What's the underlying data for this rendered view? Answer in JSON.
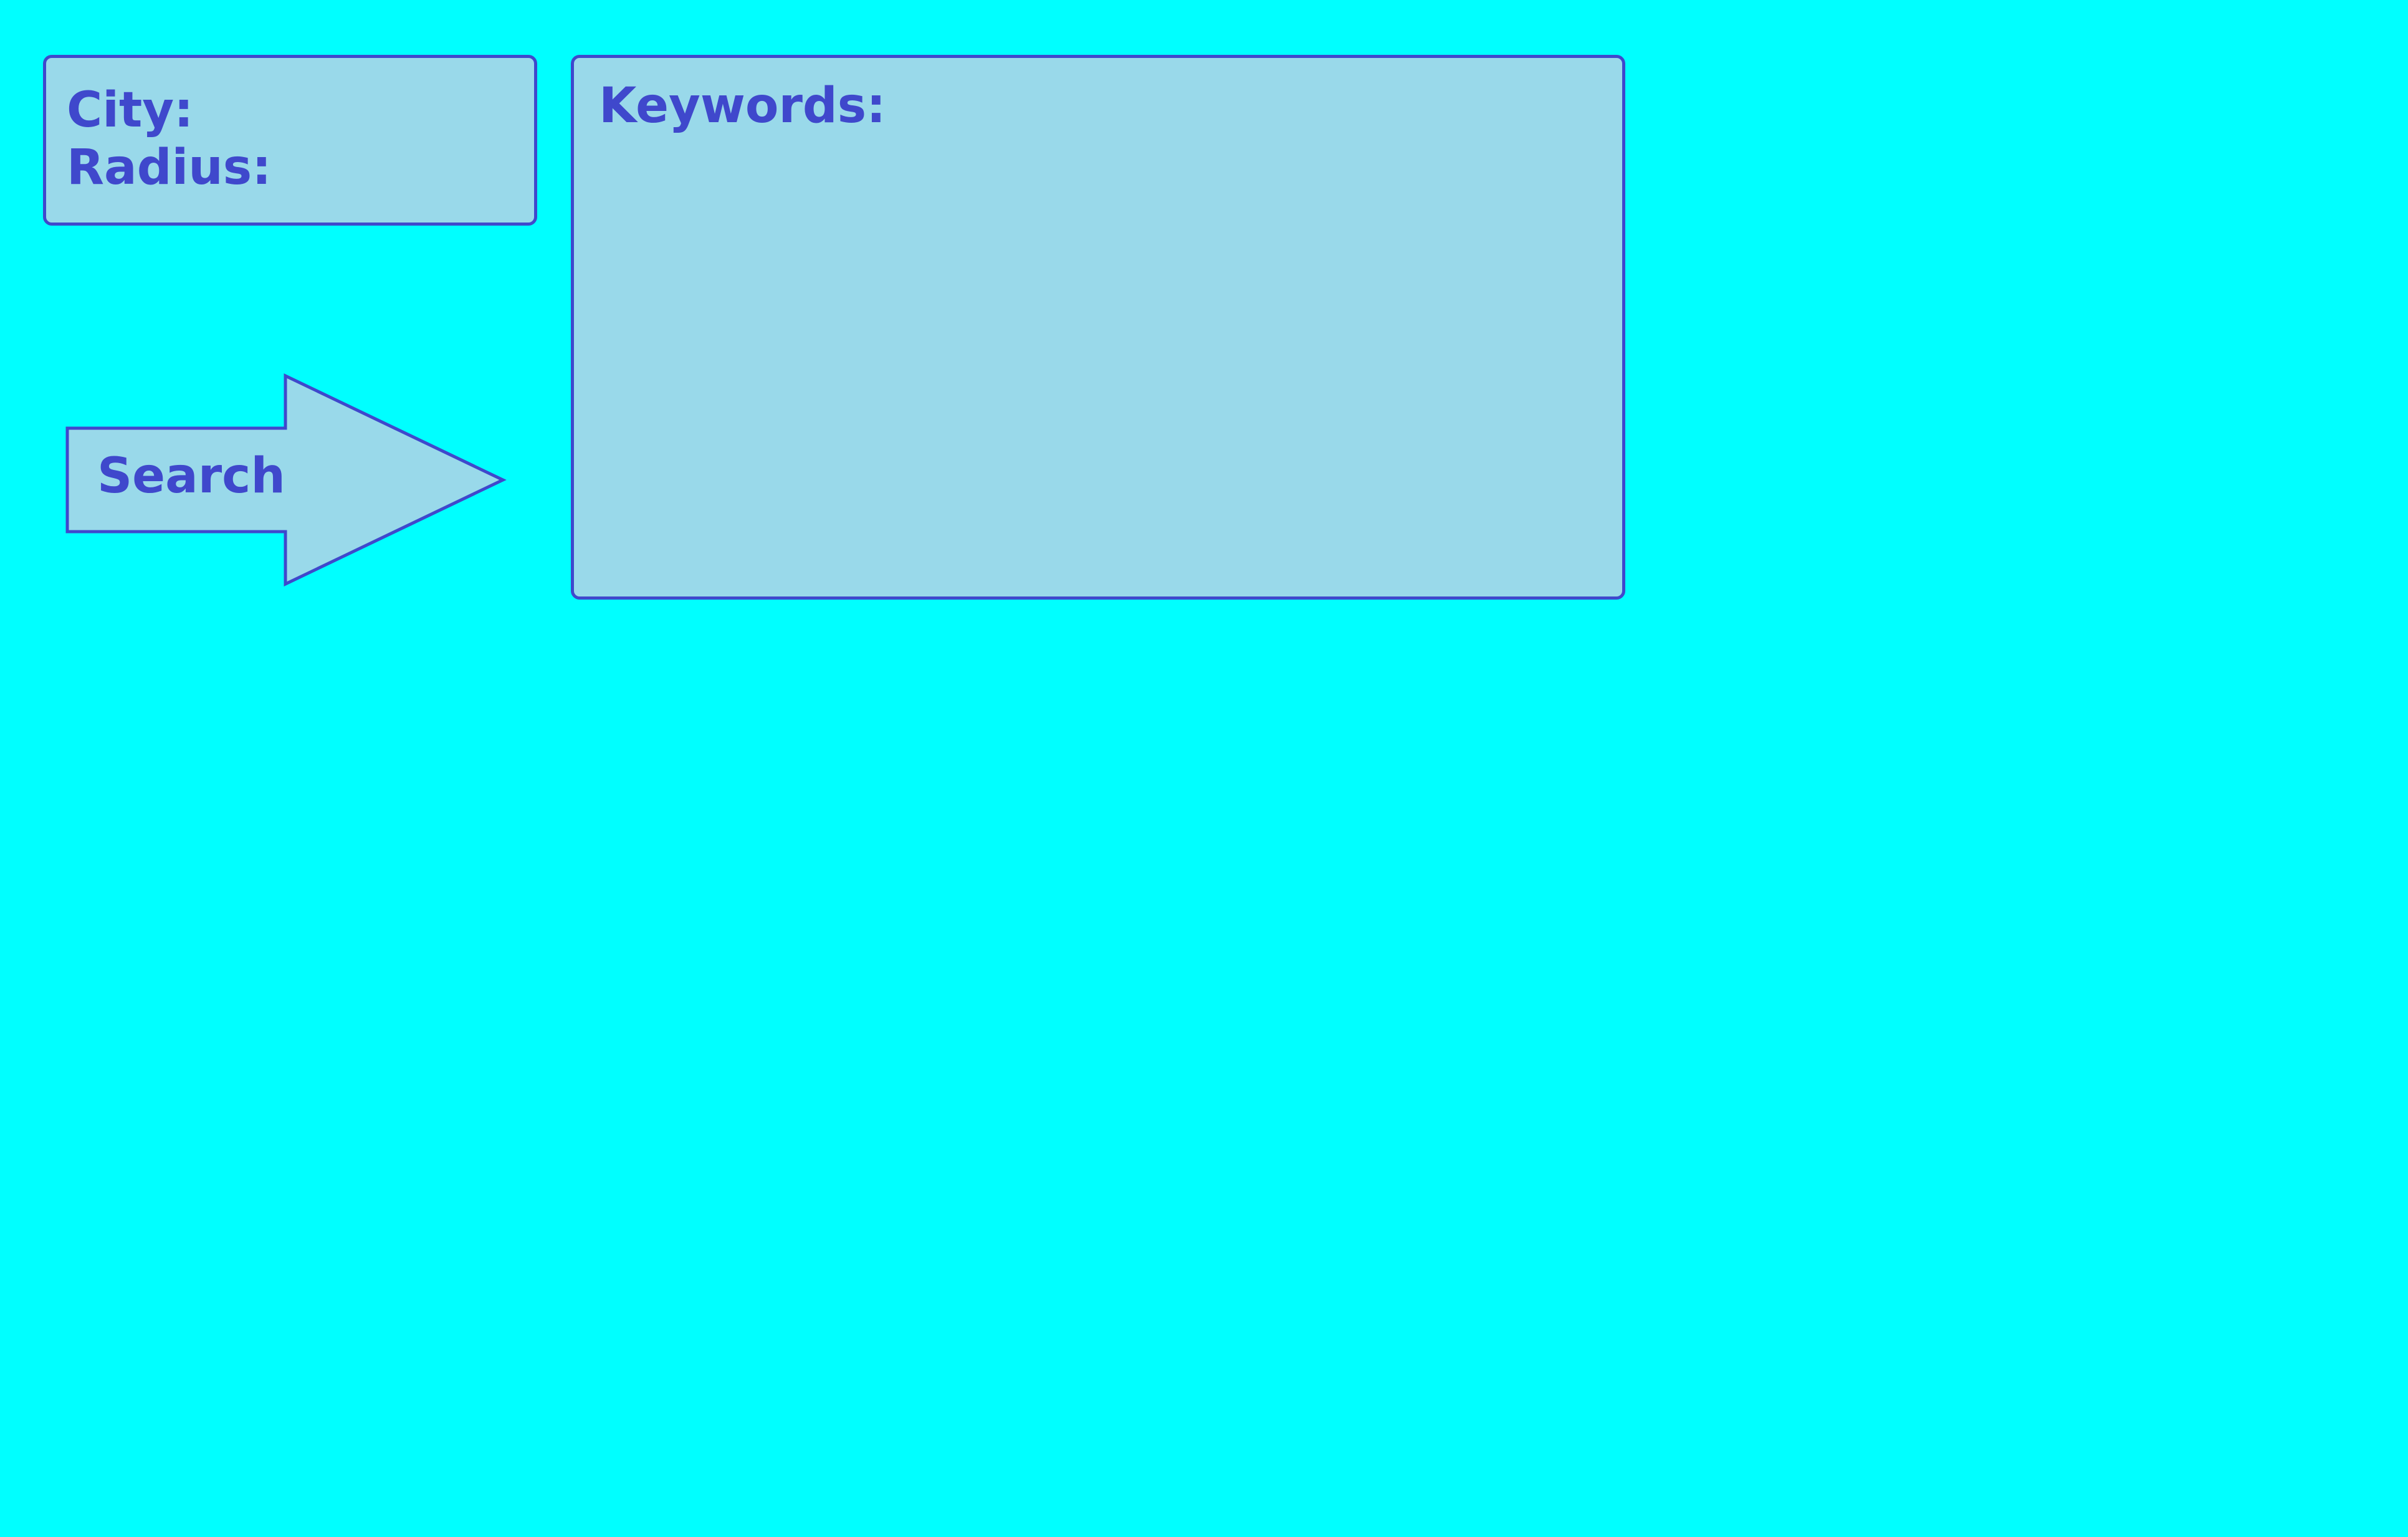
{
  "colors": {
    "background": "#00FFFF",
    "panel_fill": "#99D9EA",
    "outline": "#3F48CC",
    "text": "#3F48CC"
  },
  "location_panel": {
    "city_label": "City:",
    "radius_label": "Radius:"
  },
  "search_button": {
    "label": "Search",
    "shape": "right-arrow"
  },
  "keywords_panel": {
    "label": "Keywords:"
  }
}
